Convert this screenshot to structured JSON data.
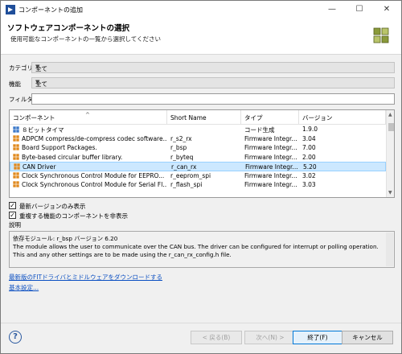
{
  "window": {
    "title": "コンポーネントの追加",
    "minimize": "—",
    "maximize": "☐",
    "close": "✕"
  },
  "header": {
    "title": "ソフトウェアコンポーネントの選択",
    "description": "使用可能なコンポーネントの一覧から選択してください"
  },
  "filters": {
    "category_label": "カテゴリ",
    "category_value": "全て",
    "function_label": "機能",
    "function_value": "全て",
    "filter_label": "フィルタ",
    "filter_value": ""
  },
  "table": {
    "columns": {
      "component": "コンポーネント",
      "short_name": "Short Name",
      "type": "タイプ",
      "version": "バージョン"
    },
    "sort_indicator": "^",
    "rows": [
      {
        "icon": "module-blue-icon",
        "name": "８ビットタイマ",
        "short_name": "",
        "type": "コード生成",
        "version": "1.9.0",
        "selected": false
      },
      {
        "icon": "module-orange-icon",
        "name": "ADPCM compress/de-compress codec software...",
        "short_name": "r_s2_rx",
        "type": "Firmware Integr...",
        "version": "3.04",
        "selected": false
      },
      {
        "icon": "module-orange-icon",
        "name": "Board Support Packages.",
        "short_name": "r_bsp",
        "type": "Firmware Integr...",
        "version": "7.00",
        "selected": false
      },
      {
        "icon": "module-orange-icon",
        "name": "Byte-based circular buffer library.",
        "short_name": "r_byteq",
        "type": "Firmware Integr...",
        "version": "2.00",
        "selected": false
      },
      {
        "icon": "module-orange-icon",
        "name": "CAN Driver",
        "short_name": "r_can_rx",
        "type": "Firmware Integr...",
        "version": "5.20",
        "selected": true
      },
      {
        "icon": "module-orange-icon",
        "name": "Clock Synchronous Control Module for EEPRO...",
        "short_name": "r_eeprom_spi",
        "type": "Firmware Integr...",
        "version": "3.02",
        "selected": false
      },
      {
        "icon": "module-orange-icon",
        "name": "Clock Synchronous Control Module for Serial Fl...",
        "short_name": "r_flash_spi",
        "type": "Firmware Integr...",
        "version": "3.03",
        "selected": false
      }
    ]
  },
  "options": {
    "latest_only_label": "最新バージョンのみ表示",
    "latest_only_checked": true,
    "hide_duplicates_label": "重複する機能のコンポーネントを非表示",
    "hide_duplicates_checked": true
  },
  "description": {
    "label": "説明",
    "lines": [
      "依存モジュール: r_bsp バージョン 6.20",
      "The module allows the user to communicate over the CAN bus. The driver can be configured for interrupt or polling operation.",
      "This and any other settings are to be made using the r_can_rx_config.h file."
    ]
  },
  "links": {
    "download": "最新版のFITドライバとミドルウェアをダウンロードする",
    "basic_settings": "基本設定..."
  },
  "footer": {
    "help_glyph": "?",
    "back": "< 戻る(B)",
    "next": "次へ(N) >",
    "finish": "終了(F)",
    "cancel": "キャンセル"
  },
  "colors": {
    "selection_bg": "#cce8ff",
    "link": "#0b4fc2",
    "module_orange": "#e08a1e",
    "module_blue": "#3a78c9"
  }
}
